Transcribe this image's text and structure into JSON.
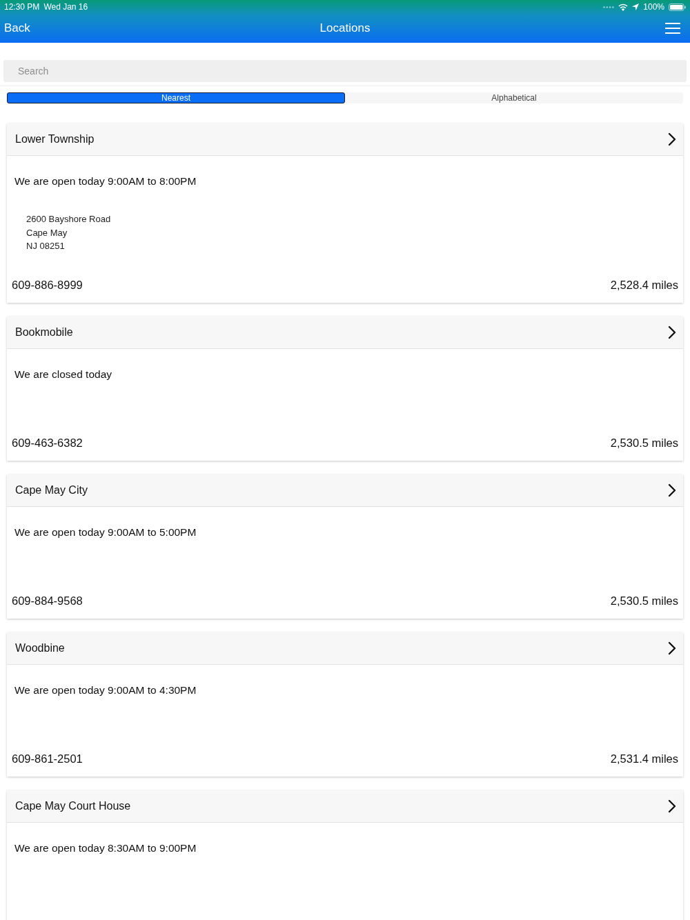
{
  "status_bar": {
    "time": "12:30 PM",
    "date": "Wed Jan 16",
    "battery": "100%"
  },
  "nav_bar": {
    "back": "Back",
    "title": "Locations"
  },
  "search": {
    "placeholder": "Search"
  },
  "segments": [
    {
      "label": "Nearest",
      "selected": true
    },
    {
      "label": "Alphabetical",
      "selected": false
    }
  ],
  "locations": [
    {
      "name": "Lower Township",
      "hours": "We are open today 9:00AM to 8:00PM",
      "address": [
        "2600 Bayshore Road",
        "Cape May",
        "NJ 08251"
      ],
      "phone": "609-886-8999",
      "distance": "2,528.4 miles"
    },
    {
      "name": "Bookmobile",
      "hours": "We are closed today",
      "phone": "609-463-6382",
      "distance": "2,530.5 miles"
    },
    {
      "name": "Cape May City",
      "hours": "We are open today 9:00AM to 5:00PM",
      "phone": "609-884-9568",
      "distance": "2,530.5 miles"
    },
    {
      "name": "Woodbine",
      "hours": "We are open today 9:00AM to 4:30PM",
      "phone": "609-861-2501",
      "distance": "2,531.4 miles"
    },
    {
      "name": "Cape May Court House",
      "hours": "We are open today 8:30AM to 9:00PM"
    }
  ]
}
